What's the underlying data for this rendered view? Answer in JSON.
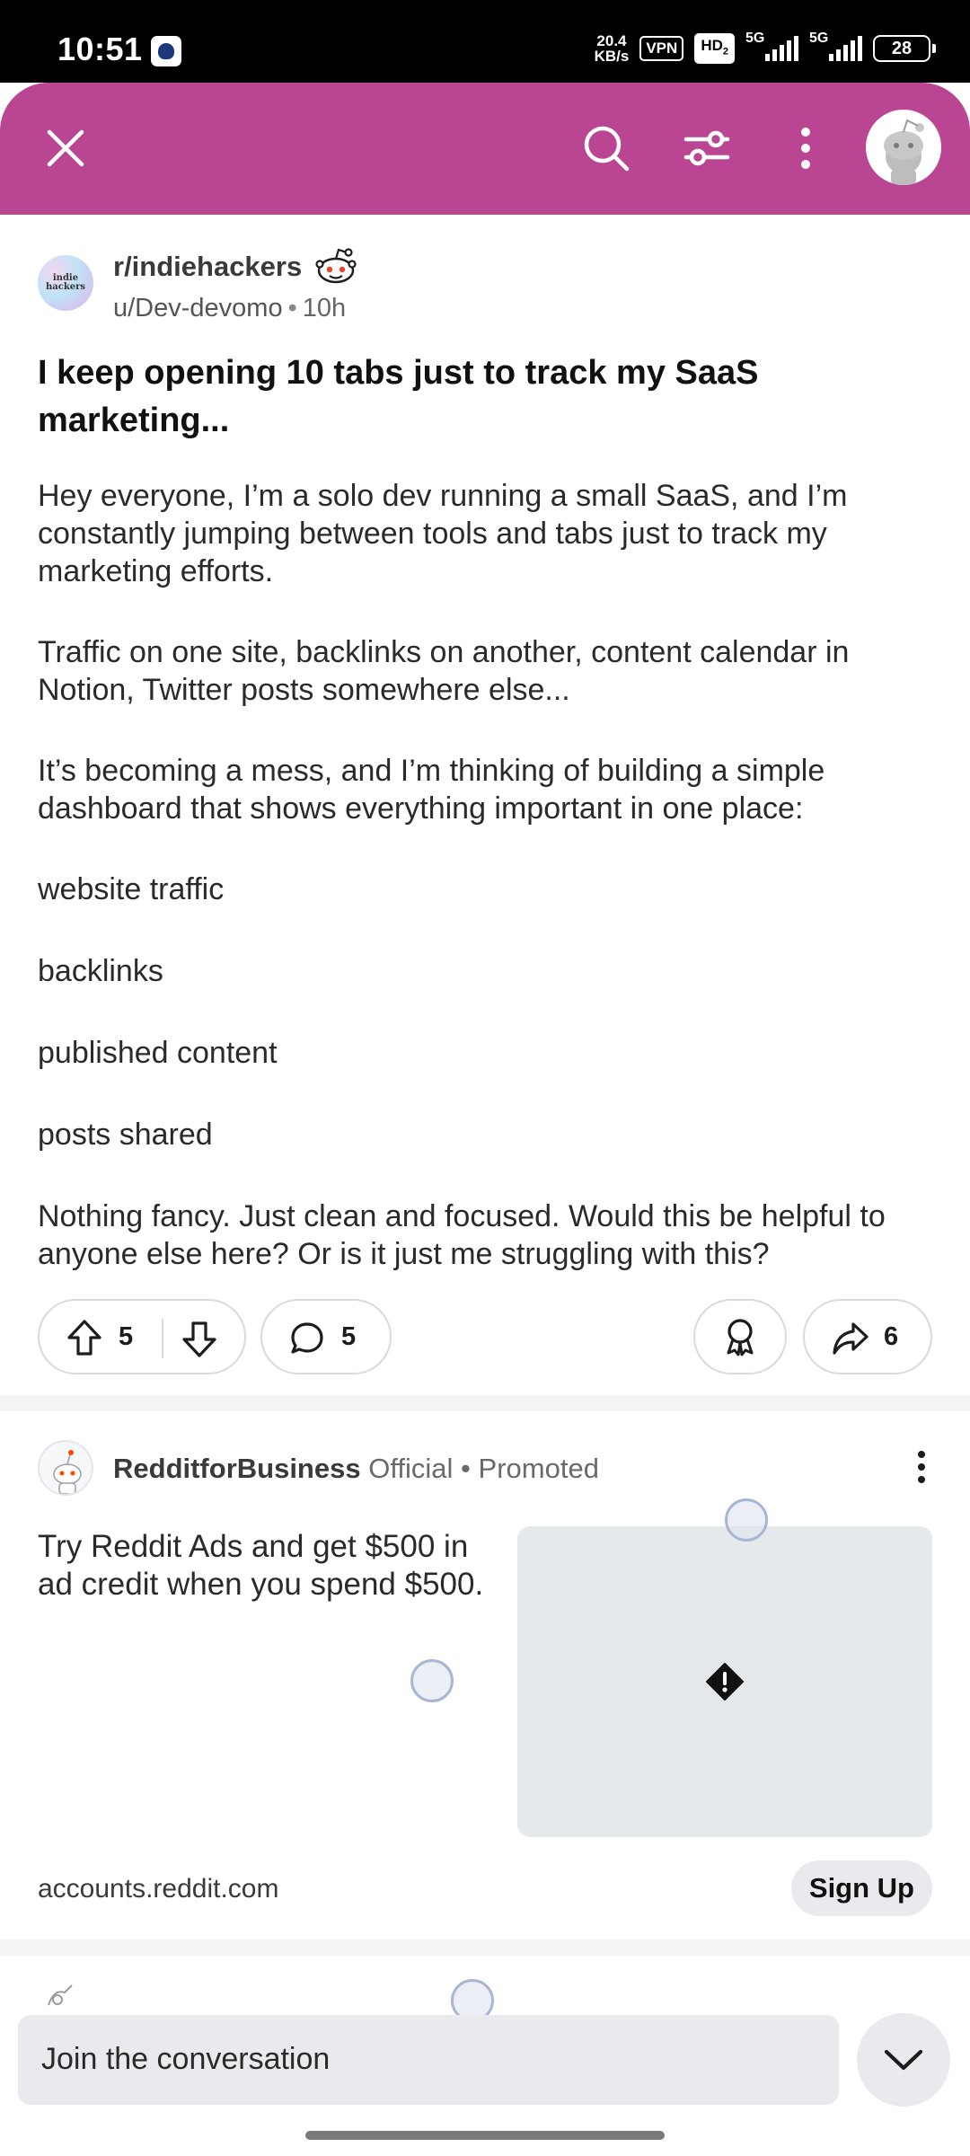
{
  "status_bar": {
    "time": "10:51",
    "net_speed_value": "20.4",
    "net_speed_unit": "KB/s",
    "vpn": "VPN",
    "hd": "HD",
    "hd_sub": "2",
    "sim1": "5G",
    "sim2": "5G",
    "battery": "28"
  },
  "header": {
    "close_icon": "close-icon",
    "search_icon": "search-icon",
    "filter_icon": "filter-icon",
    "menu_icon": "more-vertical-icon",
    "avatar_icon": "snoo-avatar-icon",
    "color": "#b94593"
  },
  "post": {
    "subreddit": "r/indiehackers",
    "subreddit_avatar_text": "indie hackers",
    "author": "u/Dev-devomo",
    "separator": "•",
    "age": "10h",
    "title": "I keep opening 10 tabs just to track my SaaS marketing...",
    "body": [
      "Hey everyone, I’m a solo dev running a small SaaS, and I’m constantly jumping between tools and tabs just to track my marketing efforts.",
      "Traffic on one site, backlinks on another, content calendar in Notion, Twitter posts somewhere else...",
      "It’s becoming a mess, and I’m thinking of building a simple dashboard that shows everything important in one place:"
    ],
    "list": [
      "website traffic",
      "backlinks",
      "published content",
      "posts shared"
    ],
    "closing": "Nothing fancy. Just clean and focused. Would this be helpful to anyone else here? Or is it just me struggling with this?",
    "upvotes": "5",
    "comments": "5",
    "shares": "6"
  },
  "ad": {
    "advertiser": "RedditforBusiness",
    "official": "Official",
    "separator": "•",
    "promoted": "Promoted",
    "text": "Try Reddit Ads and get $500 in ad credit when you spend $500.",
    "media_icon": "error-icon",
    "domain": "accounts.reddit.com",
    "cta": "Sign Up"
  },
  "footer": {
    "placeholder": "Join the conversation",
    "collapse_icon": "chevron-down-icon"
  }
}
